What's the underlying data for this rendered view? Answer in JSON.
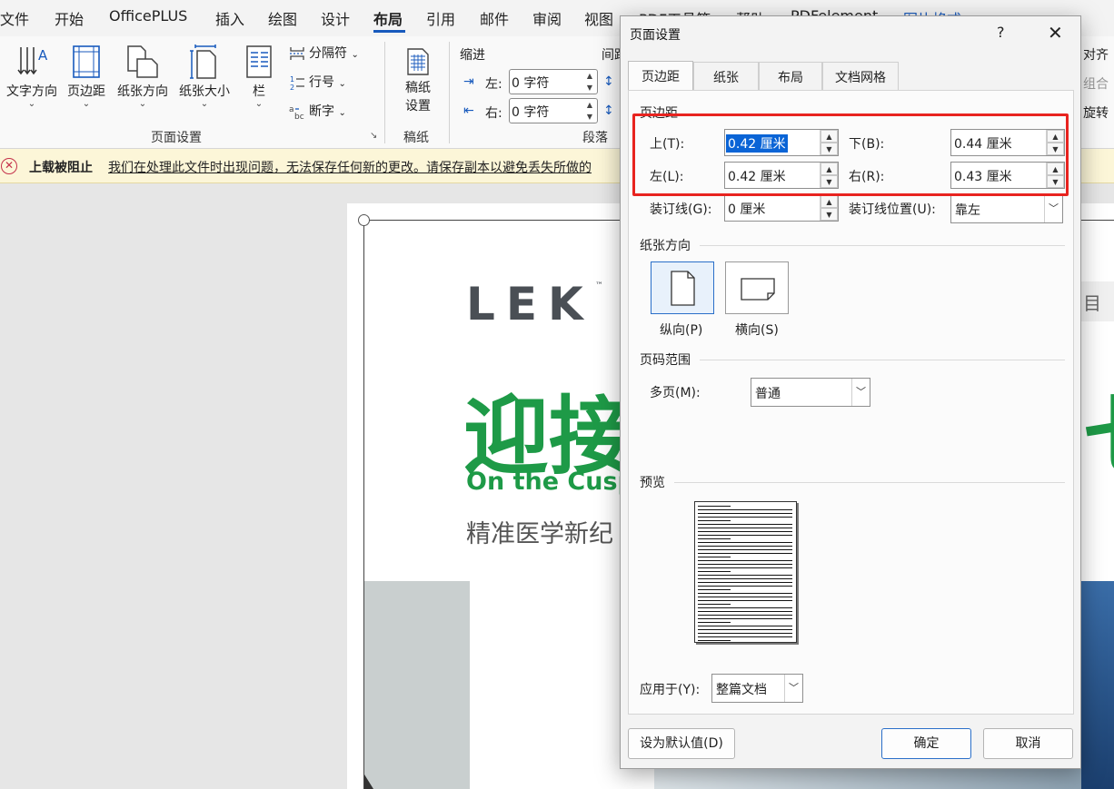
{
  "ribbon_tabs": [
    "文件",
    "开始",
    "OfficePLUS",
    "插入",
    "绘图",
    "设计",
    "布局",
    "引用",
    "邮件",
    "审阅",
    "视图",
    "PDF工具箱",
    "帮助",
    "PDFelement",
    "图片格式"
  ],
  "active_tab": "布局",
  "ribbon": {
    "text_direction": "文字方向",
    "margins": "页边距",
    "orientation": "纸张方向",
    "size": "纸张大小",
    "columns": "栏",
    "breaks": "分隔符",
    "line_numbers": "行号",
    "hyphenation": "断字",
    "page_setup_group": "页面设置",
    "manuscript_btn_line1": "稿纸",
    "manuscript_btn_line2": "设置",
    "manuscript_group": "稿纸",
    "indent_label": "缩进",
    "spacing_label": "间距",
    "indent_left_label": "左:",
    "indent_left_value": "0 字符",
    "indent_right_label": "右:",
    "indent_right_value": "0 字符",
    "paragraph_group": "段落",
    "right_align": "对齐",
    "right_group": "组合",
    "right_rotate": "旋转"
  },
  "warning": {
    "title": "上载被阻止",
    "message": "我们在处理此文件时出现问题，无法保存任何新的更改。请保存副本以避免丢失所做的"
  },
  "document": {
    "logo": "LEK",
    "logo_tm": "™",
    "headline_cn": "迎接",
    "headline_right": "七",
    "headline_en": "On the Cusp",
    "subtitle_cn": "精准医学新纪",
    "side_tab_glyph": "目"
  },
  "dialog": {
    "title": "页面设置",
    "help": "?",
    "close": "✕",
    "tabs": [
      "页边距",
      "纸张",
      "布局",
      "文档网格"
    ],
    "active_tab": "页边距",
    "margins_section": "页边距",
    "top_label": "上(T):",
    "top_value": "0.42 厘米",
    "bottom_label": "下(B):",
    "bottom_value": "0.44 厘米",
    "left_label": "左(L):",
    "left_value": "0.42 厘米",
    "right_label": "右(R):",
    "right_value": "0.43 厘米",
    "gutter_label": "装订线(G):",
    "gutter_value": "0 厘米",
    "gutter_pos_label": "装订线位置(U):",
    "gutter_pos_value": "靠左",
    "orientation_section": "纸张方向",
    "portrait": "纵向(P)",
    "landscape": "横向(S)",
    "pages_section": "页码范围",
    "multiple_pages_label": "多页(M):",
    "multiple_pages_value": "普通",
    "preview_section": "预览",
    "apply_to_label": "应用于(Y):",
    "apply_to_value": "整篇文档",
    "default_button": "设为默认值(D)",
    "ok_button": "确定",
    "cancel_button": "取消"
  },
  "colors": {
    "highlight_box": "#e8231f",
    "brand_green": "#1e9a47",
    "accent_blue": "#185abd"
  }
}
